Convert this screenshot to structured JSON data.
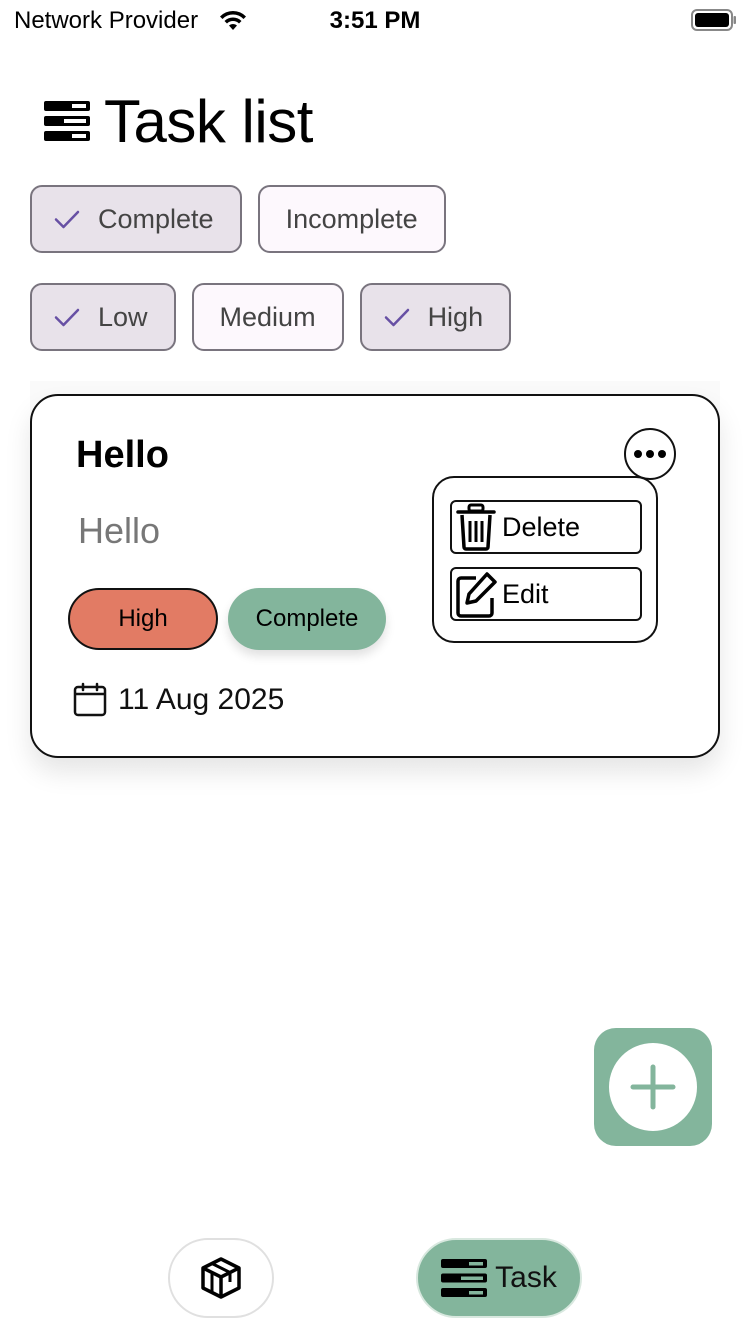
{
  "status_bar": {
    "carrier": "Network Provider",
    "time": "3:51 PM",
    "wifi_icon": "wifi-icon",
    "battery_icon": "battery-icon"
  },
  "header": {
    "title": "Task list",
    "icon": "task-list-icon"
  },
  "filters": {
    "status": [
      {
        "label": "Complete",
        "selected": true
      },
      {
        "label": "Incomplete",
        "selected": false
      }
    ],
    "priority": [
      {
        "label": "Low",
        "selected": true
      },
      {
        "label": "Medium",
        "selected": false
      },
      {
        "label": "High",
        "selected": true
      }
    ]
  },
  "tasks": [
    {
      "title": "Hello",
      "description": "Hello",
      "priority": "High",
      "status": "Complete",
      "date": "11 Aug 2025"
    }
  ],
  "task_menu": {
    "delete_label": "Delete",
    "edit_label": "Edit"
  },
  "colors": {
    "accent_green": "#83b59c",
    "priority_high": "#e27b64",
    "check_purple": "#6750a4",
    "chip_selected_bg": "#e8e2ea",
    "chip_bg": "#fdf8fd"
  },
  "fab": {
    "icon": "plus-icon"
  },
  "bottom_nav": {
    "home_icon": "cube-icon",
    "task_label": "Task",
    "task_icon": "task-list-icon"
  }
}
